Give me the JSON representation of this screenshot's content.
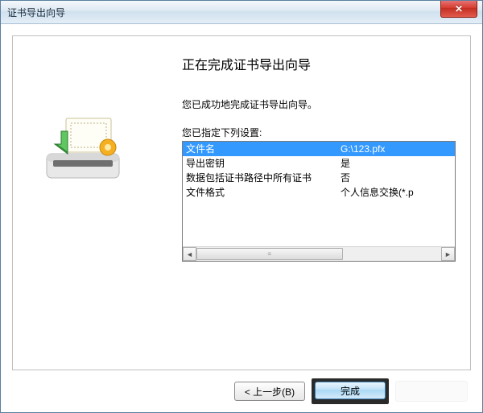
{
  "window": {
    "title": "证书导出向导"
  },
  "wizard": {
    "heading": "正在完成证书导出向导",
    "success_msg": "您已成功地完成证书导出向导。",
    "settings_intro": "您已指定下列设置:",
    "rows": [
      {
        "label": "文件名",
        "value": "G:\\123.pfx"
      },
      {
        "label": "导出密钥",
        "value": "是"
      },
      {
        "label": "数据包括证书路径中所有证书",
        "value": "否"
      },
      {
        "label": "文件格式",
        "value": "个人信息交换(*.p"
      }
    ]
  },
  "buttons": {
    "back": "< 上一步(B)",
    "finish": "完成"
  },
  "icons": {
    "close": "✕",
    "scroll_left": "◄",
    "scroll_right": "►",
    "thumb_grip": "≡"
  }
}
